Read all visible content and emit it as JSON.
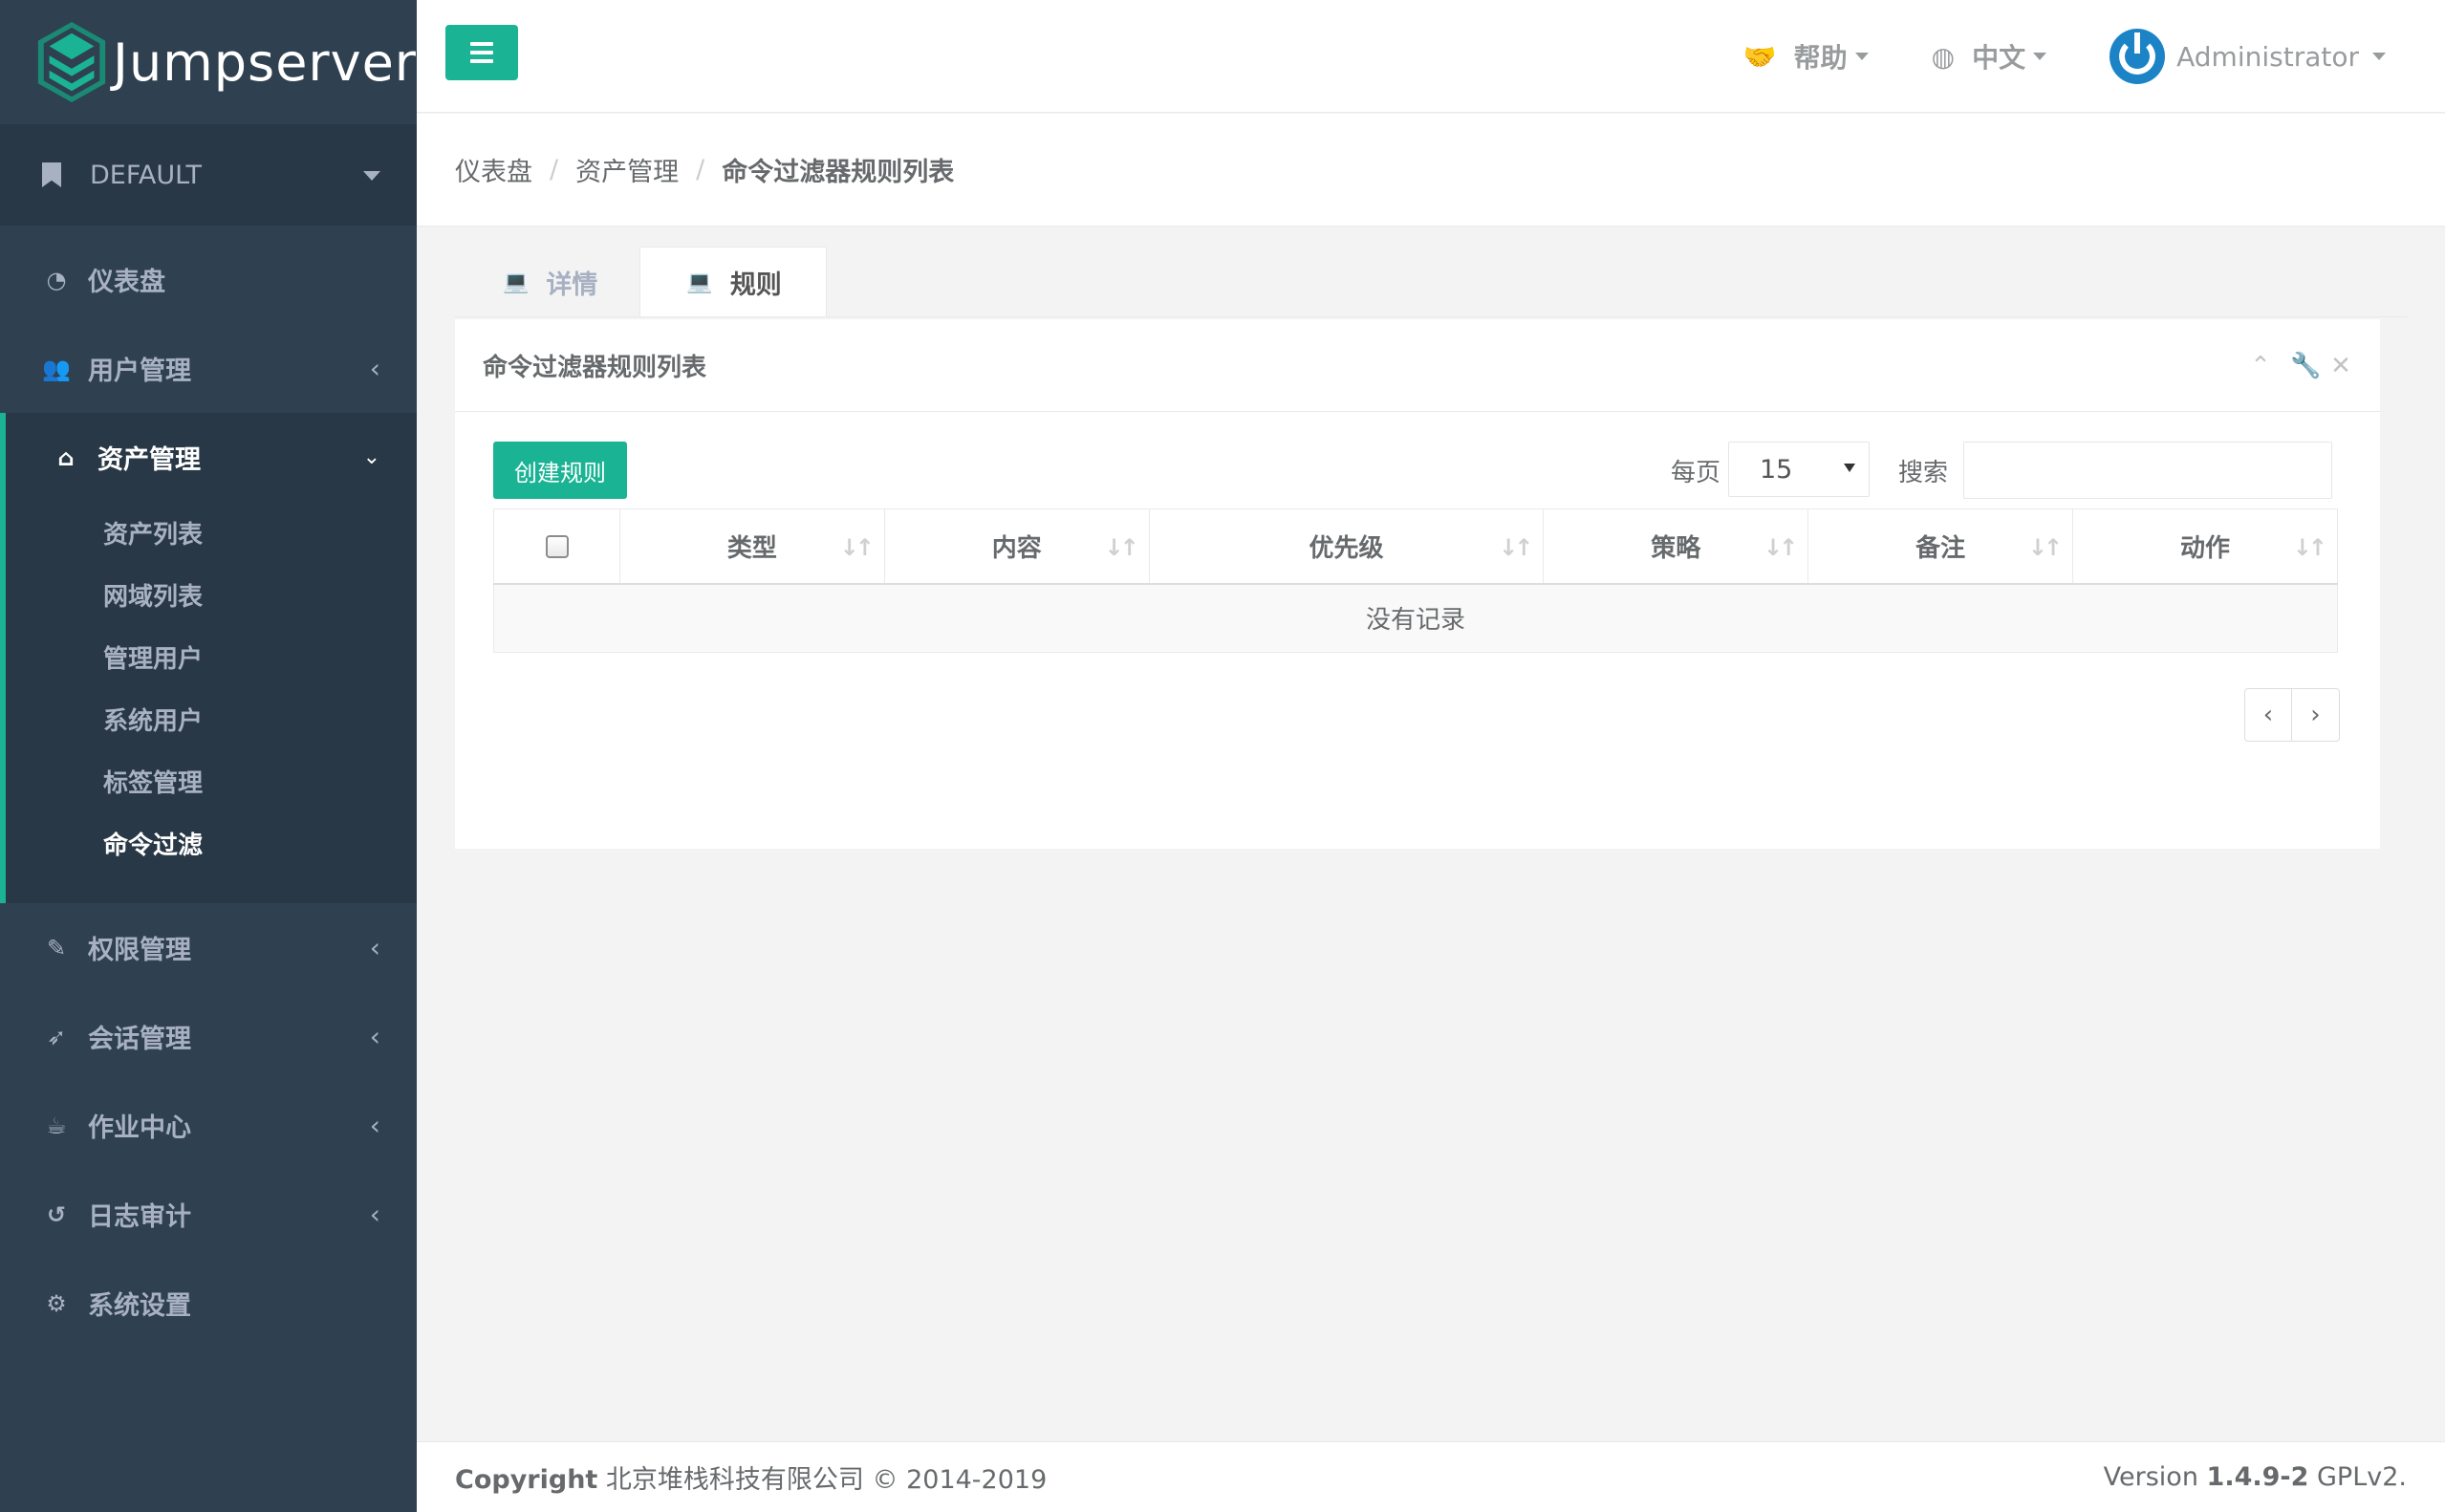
{
  "app": {
    "logo_text": "Jumpserver",
    "org": "DEFAULT"
  },
  "colors": {
    "sidebar_bg": "#2f4050",
    "sidebar_active_bg": "#293846",
    "accent": "#1ab394",
    "avatar": "#1c84c6"
  },
  "nav": {
    "dashboard": "仪表盘",
    "users": "用户管理",
    "assets": "资产管理",
    "assets_sub": [
      "资产列表",
      "网域列表",
      "管理用户",
      "系统用户",
      "标签管理",
      "命令过滤"
    ],
    "perms": "权限管理",
    "sessions": "会话管理",
    "jobs": "作业中心",
    "audits": "日志审计",
    "settings": "系统设置"
  },
  "topbar": {
    "help": "帮助",
    "language": "中文",
    "user": "Administrator"
  },
  "breadcrumb": [
    "仪表盘",
    "资产管理",
    "命令过滤器规则列表"
  ],
  "tabs": [
    "详情",
    "规则"
  ],
  "panel": {
    "title": "命令过滤器规则列表",
    "create_button": "创建规则",
    "per_page_label": "每页",
    "per_page_value": "15",
    "search_label": "搜索",
    "search_value": "",
    "columns": [
      "类型",
      "内容",
      "优先级",
      "策略",
      "备注",
      "动作"
    ],
    "empty_text": "没有记录",
    "prev": "‹",
    "next": "›"
  },
  "footer": {
    "copyright_label": "Copyright",
    "copyright_text": "北京堆栈科技有限公司 © 2014-2019",
    "version_label": "Version",
    "version": "1.4.9-2",
    "license": "GPLv2."
  }
}
